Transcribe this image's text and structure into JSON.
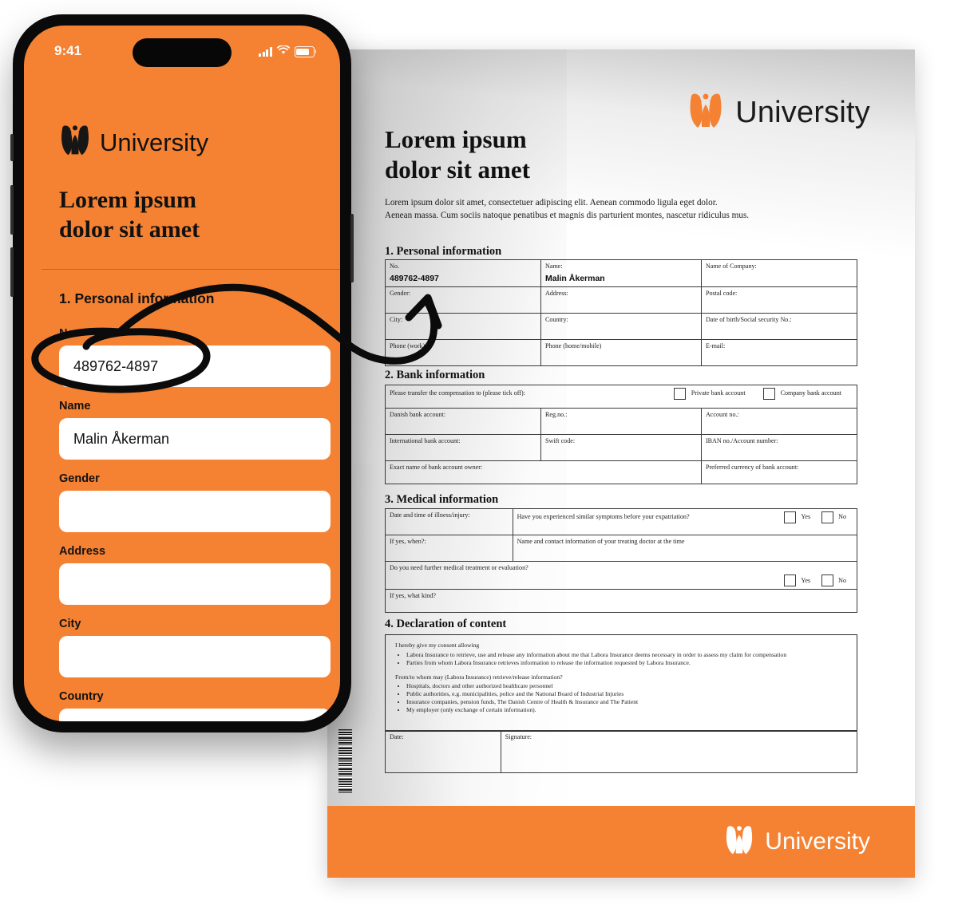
{
  "brand": {
    "name": "University",
    "logo_icon": "university-tulip-logo-icon",
    "accent": "#F58233"
  },
  "phone": {
    "status": {
      "time": "9:41",
      "signal_icon": "cellular-signal-icon",
      "wifi_icon": "wifi-icon",
      "battery_icon": "battery-full-icon"
    },
    "brand_label": "University",
    "title": "Lorem ipsum\ndolor sit amet",
    "section_label": "1. Personal information",
    "fields": [
      {
        "label": "No.",
        "value": "489762-4897",
        "placeholder": ""
      },
      {
        "label": "Name",
        "value": "Malin Åkerman",
        "placeholder": ""
      },
      {
        "label": "Gender",
        "value": "",
        "placeholder": ""
      },
      {
        "label": "Address",
        "value": "",
        "placeholder": ""
      },
      {
        "label": "City",
        "value": "",
        "placeholder": ""
      },
      {
        "label": "Country",
        "value": "",
        "placeholder": ""
      }
    ]
  },
  "annotation": {
    "circle_target": "No. field on phone",
    "arrow_target": "No. cell in document personal information table",
    "stroke_color": "#0b0b0b"
  },
  "document": {
    "brand_label": "University",
    "title": "Lorem ipsum\ndolor sit amet",
    "intro": "Lorem ipsum dolor sit amet, consectetuer adipiscing elit. Aenean commodo ligula eget dolor.\nAenean massa. Cum sociis natoque penatibus et magnis dis parturient montes, nascetur ridiculus mus.",
    "section1": {
      "heading": "1. Personal information",
      "cells": [
        [
          {
            "label": "No.",
            "value": "489762-4897"
          },
          {
            "label": "Name:",
            "value": "Malin Åkerman"
          },
          {
            "label": "Name of Company:",
            "value": ""
          }
        ],
        [
          {
            "label": "Gender:",
            "value": ""
          },
          {
            "label": "Address:",
            "value": ""
          },
          {
            "label": "Postal code:",
            "value": ""
          }
        ],
        [
          {
            "label": "City:",
            "value": ""
          },
          {
            "label": "Country:",
            "value": ""
          },
          {
            "label": "Date of birth/Social security No.:",
            "value": ""
          }
        ],
        [
          {
            "label": "Phone (work):",
            "value": ""
          },
          {
            "label": "Phone (home/mobile)",
            "value": ""
          },
          {
            "label": "E-mail:",
            "value": ""
          }
        ]
      ]
    },
    "section2": {
      "heading": "2. Bank information",
      "transfer_prompt": "Please transfer the compensation to (please tick off):",
      "option_private": "Private bank account",
      "option_company": "Company bank account",
      "rows": [
        [
          "Danish bank account:",
          "Reg.no.:",
          "Account no.:"
        ],
        [
          "International bank account:",
          "Swift code:",
          "IBAN no./Account number:"
        ]
      ],
      "owner_label": "Exact name of bank account owner:",
      "currency_label": "Preferred currency of bank account:"
    },
    "section3": {
      "heading": "3. Medical information",
      "date_label": "Date and time of illness/injury:",
      "similar_q": "Have you experienced similar symptoms before your expatriation?",
      "ifyes_when": "If yes, when?:",
      "doctor_label": "Name and contact information of your treating doctor at the time",
      "further_q": "Do you need further medical treatment or evaluation?",
      "ifyes_what": "If yes, what kind?",
      "yes": "Yes",
      "no": "No"
    },
    "section4": {
      "heading": "4. Declaration of content",
      "consent_intro": "I hereby give my consent allowing",
      "consent_items": [
        "Labora Insurance to retrieve, use and release any information about me that Labora Insurance deems necessary in order to assess my claim for compensation",
        "Parties from whom Labora Insurance retrieves information to release the information requested by Labora Insurance."
      ],
      "retrieve_intro": "From/to whom may (Labora Insurance) retrieve/release information?",
      "retrieve_items": [
        "Hospitals, doctors and other authorized healthcare personnel",
        "Public authorities, e.g. municipalities, police and the National Board of Industrial Injuries",
        "Insurance companies, pension funds, The Danish Centre of Health & Insurance and The Patient",
        "My employer (only exchange of certain information)."
      ],
      "date_label": "Date:",
      "signature_label": "Signature:"
    },
    "barcode_icon": "vertical-barcode-icon",
    "footer_label": "University"
  }
}
